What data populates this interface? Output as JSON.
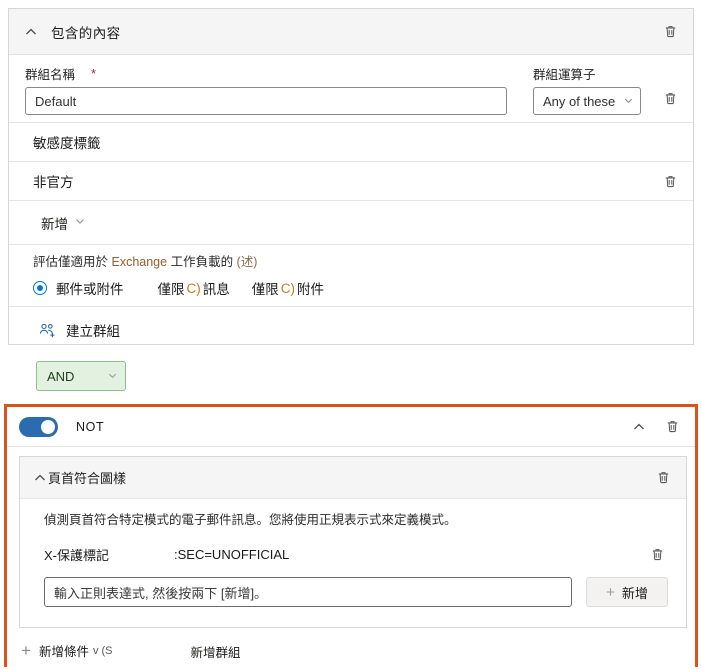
{
  "included_content": {
    "header_title": "包含的內容",
    "collapse_icon": "chevron-up-icon",
    "delete_icon": "trash-icon",
    "group_name": {
      "label": "群組名稱",
      "required_marker": "*",
      "value": "Default"
    },
    "group_operator": {
      "label": "群組運算子",
      "value": "Any of these",
      "caret_icon": "chevron-down-icon"
    },
    "sensitivity_label_row": "敏感度標籤",
    "non_official_row": "非官方",
    "add_row": {
      "label": "新增",
      "caret_icon": "chevron-down-icon"
    },
    "exchange_note": {
      "prefix": "評估僅適用於 ",
      "accent": "Exchange",
      "middle": " 工作負載的 ",
      "suffix": "(述)"
    },
    "radio_options": [
      {
        "label": "郵件或附件",
        "checked": true
      },
      {
        "prefix": "僅限 ",
        "glyph": "C)",
        "suffix": " 訊息",
        "checked": false
      },
      {
        "prefix": "僅限 ",
        "glyph": "C)",
        "suffix": " 附件",
        "checked": false
      }
    ],
    "create_group": {
      "label": "建立群組",
      "icon": "people-add-icon"
    }
  },
  "operator_dropdown": {
    "value": "AND",
    "caret_icon": "chevron-down-icon"
  },
  "not_block": {
    "toggle_label": "NOT",
    "toggle_on": true,
    "collapse_icon": "chevron-up-icon",
    "delete_icon": "trash-icon",
    "header_pattern": {
      "title": "頁首符合圖樣",
      "collapse_icon": "chevron-up-icon",
      "delete_icon": "trash-icon",
      "description": "偵測頁首符合特定模式的電子郵件訊息。您將使用正規表示式來定義模式。",
      "tag": {
        "key": "X-保護標記",
        "value": ":SEC=UNOFFICIAL",
        "delete_icon": "trash-icon"
      },
      "regex_input_placeholder": "輸入正則表達式, 然後按兩下 [新增]。",
      "add_button_label": "新增"
    },
    "bottom_actions": {
      "add_condition": "新增條件",
      "add_condition_suffix": "v (S",
      "add_group": "新增群組"
    }
  },
  "colors": {
    "accent_blue": "#0078d4",
    "toggle_blue": "#2b6cb0",
    "not_border_orange": "#d9541a",
    "and_green_bg": "#e3f1e0",
    "and_green_border": "#8cbf8a",
    "required_red": "#a4262c"
  }
}
